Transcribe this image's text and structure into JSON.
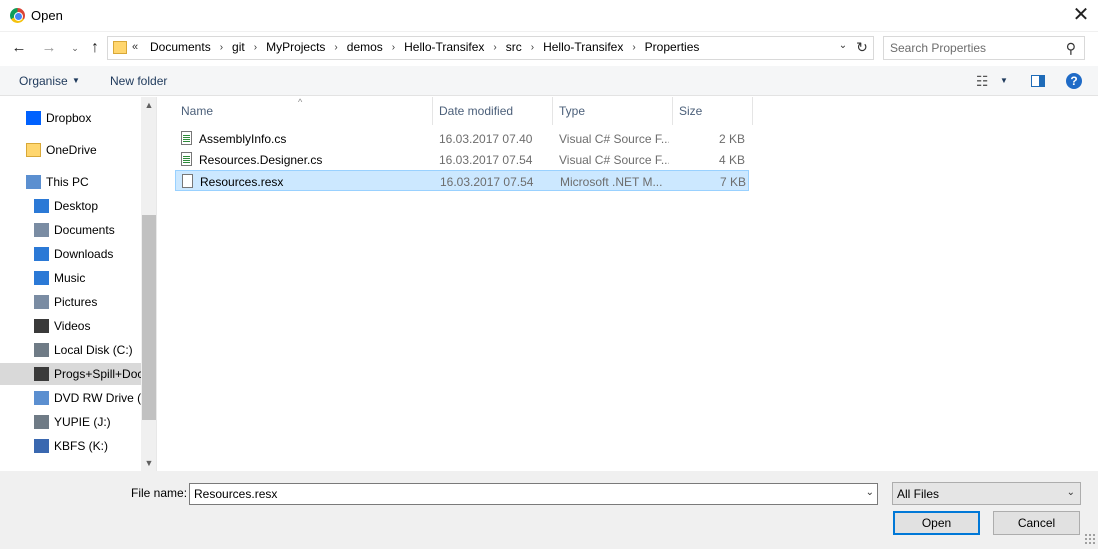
{
  "window": {
    "title": "Open",
    "close_glyph": "✕"
  },
  "nav": {
    "back_glyph": "←",
    "forward_glyph": "→",
    "recent_glyph": "⌄",
    "up_glyph": "↑",
    "address_overflow": "«",
    "breadcrumbs": [
      "Documents",
      "git",
      "MyProjects",
      "demos",
      "Hello-Transifex",
      "src",
      "Hello-Transifex",
      "Properties"
    ],
    "crumb_separator": "›",
    "dropdown_glyph": "⌄",
    "refresh_glyph": "↻",
    "search_placeholder": "Search Properties",
    "search_glyph": "⚲"
  },
  "toolbar": {
    "organise_label": "Organise",
    "organise_arrow": "▼",
    "new_folder_label": "New folder",
    "view_glyph": "☷",
    "view_arrow": "▼",
    "help_label": "?"
  },
  "sidebar": {
    "scroll_up": "▲",
    "scroll_down": "▼",
    "items": [
      {
        "label": "Dropbox",
        "icon": "dropbox-icon",
        "indent": 0,
        "color": "#0061fe"
      },
      {
        "label": "OneDrive",
        "icon": "folder-icon",
        "indent": 0,
        "color": "#ffd66e"
      },
      {
        "label": "This PC",
        "icon": "computer-icon",
        "indent": 0,
        "color": "#5b8fd0"
      },
      {
        "label": "Desktop",
        "icon": "desktop-icon",
        "indent": 1,
        "color": "#2b79d6"
      },
      {
        "label": "Documents",
        "icon": "documents-icon",
        "indent": 1,
        "color": "#7a8ca3"
      },
      {
        "label": "Downloads",
        "icon": "downloads-icon",
        "indent": 1,
        "color": "#2b79d6"
      },
      {
        "label": "Music",
        "icon": "music-icon",
        "indent": 1,
        "color": "#2b79d6"
      },
      {
        "label": "Pictures",
        "icon": "pictures-icon",
        "indent": 1,
        "color": "#7a8ca3"
      },
      {
        "label": "Videos",
        "icon": "videos-icon",
        "indent": 1,
        "color": "#3a3a3a"
      },
      {
        "label": "Local Disk (C:)",
        "icon": "local-disk-icon",
        "indent": 1,
        "color": "#6f7b86"
      },
      {
        "label": "Progs+Spill+Docs (D:)",
        "icon": "drive-icon",
        "indent": 1,
        "color": "#3a3a3a",
        "selected": true
      },
      {
        "label": "DVD RW Drive (E:)",
        "icon": "dvd-drive-icon",
        "indent": 1,
        "color": "#5b8fd0"
      },
      {
        "label": "YUPIE (J:)",
        "icon": "usb-drive-icon",
        "indent": 1,
        "color": "#6f7b86"
      },
      {
        "label": "KBFS (K:)",
        "icon": "kbfs-drive-icon",
        "indent": 1,
        "color": "#3a68b0"
      }
    ]
  },
  "filelist": {
    "columns": [
      "Name",
      "Date modified",
      "Type",
      "Size"
    ],
    "sort_glyph": "^",
    "files": [
      {
        "name": "AssemblyInfo.cs",
        "date": "16.03.2017 07.40",
        "type": "Visual C# Source F...",
        "size": "2 KB",
        "kind": "cs"
      },
      {
        "name": "Resources.Designer.cs",
        "date": "16.03.2017 07.54",
        "type": "Visual C# Source F...",
        "size": "4 KB",
        "kind": "cs"
      },
      {
        "name": "Resources.resx",
        "date": "16.03.2017 07.54",
        "type": "Microsoft .NET M...",
        "size": "7 KB",
        "kind": "resx",
        "selected": true
      }
    ]
  },
  "footer": {
    "file_name_label": "File name:",
    "file_name_value": "Resources.resx",
    "file_name_drop": "⌄",
    "file_type": "All Files",
    "file_type_drop": "⌄",
    "open_label": "Open",
    "cancel_label": "Cancel"
  }
}
